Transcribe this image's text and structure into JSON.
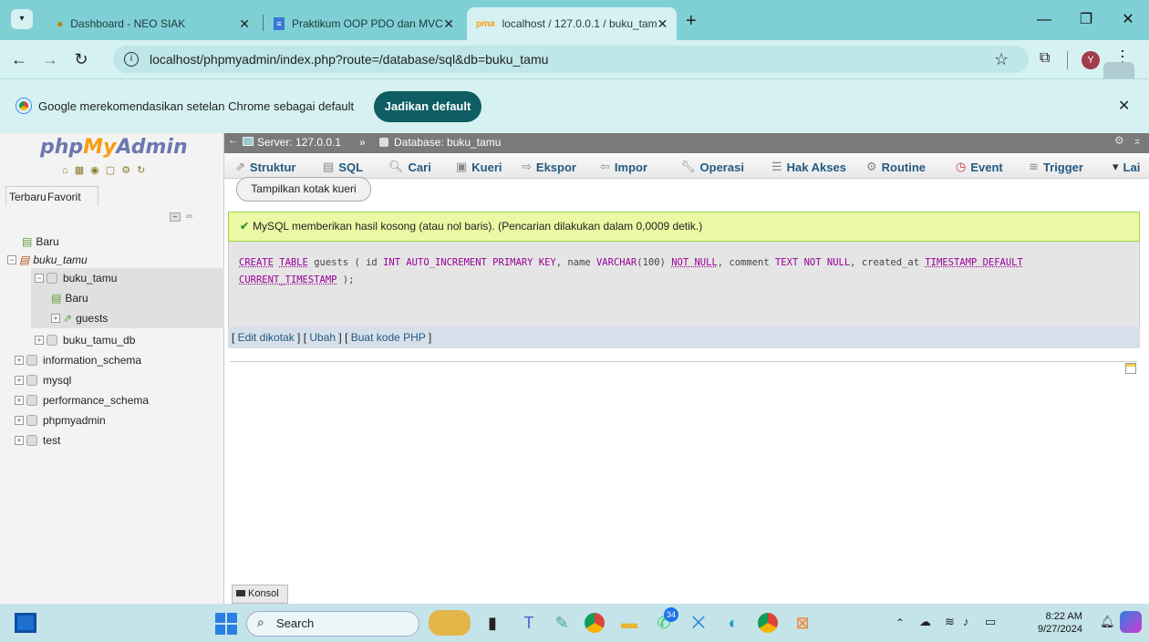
{
  "browser": {
    "tabs": [
      {
        "title": "Dashboard - NEO SIAK"
      },
      {
        "title": "Praktikum OOP PDO dan MVC"
      },
      {
        "title": "localhost / 127.0.0.1 / buku_tam"
      }
    ],
    "url": "localhost/phpmyadmin/index.php?route=/database/sql&db=buku_tamu",
    "profile_initial": "Y",
    "infobar_text": "Google merekomendasikan setelan Chrome sebagai default",
    "infobar_button": "Jadikan default"
  },
  "sidebar": {
    "logo_php": "php",
    "logo_my": "My",
    "logo_admin": "Admin",
    "tab_recent": "Terbaru",
    "tab_favorite": "Favorit",
    "tree": [
      {
        "label": "Baru"
      },
      {
        "label": "buku_tamu"
      },
      {
        "label": "buku_tamu"
      },
      {
        "label": "Baru"
      },
      {
        "label": "guests"
      },
      {
        "label": "buku_tamu_db"
      },
      {
        "label": "information_schema"
      },
      {
        "label": "mysql"
      },
      {
        "label": "performance_schema"
      },
      {
        "label": "phpmyadmin"
      },
      {
        "label": "test"
      }
    ]
  },
  "breadcrumb": {
    "server": "Server: 127.0.0.1",
    "sep": "»",
    "database": "Database: buku_tamu"
  },
  "menu": [
    "Struktur",
    "SQL",
    "Cari",
    "Kueri",
    "Ekspor",
    "Impor",
    "Operasi",
    "Hak Akses",
    "Routine",
    "Event",
    "Trigger",
    "Lai"
  ],
  "content": {
    "show_query_button": "Tampilkan kotak kueri",
    "success_message": "MySQL memberikan hasil kosong (atau nol baris). (Pencarian dilakukan dalam 0,0009 detik.)",
    "sql_line1_kw1": "CREATE",
    "sql_line1_kw2": "TABLE",
    "sql_line1_a": " guests ( id ",
    "sql_line1_kw3": "INT AUTO_INCREMENT PRIMARY KEY",
    "sql_line1_b": ", name ",
    "sql_line1_kw4": "VARCHAR",
    "sql_line1_c": "(100) ",
    "sql_line1_kw5": "NOT NULL",
    "sql_line1_d": ", comment ",
    "sql_line1_kw6": "TEXT NOT NULL",
    "sql_line1_e": ", created_at ",
    "sql_line1_kw7": "TIMESTAMP DEFAULT",
    "sql_line2_kw": "CURRENT_TIMESTAMP",
    "sql_line2_tail": " );",
    "link_edit_inline": "Edit dikotak",
    "link_edit": "Ubah",
    "link_php": "Buat kode PHP",
    "console": "Konsol"
  },
  "taskbar": {
    "search": "Search",
    "chat_badge": "34",
    "time": "8:22 AM",
    "date": "9/27/2024"
  }
}
